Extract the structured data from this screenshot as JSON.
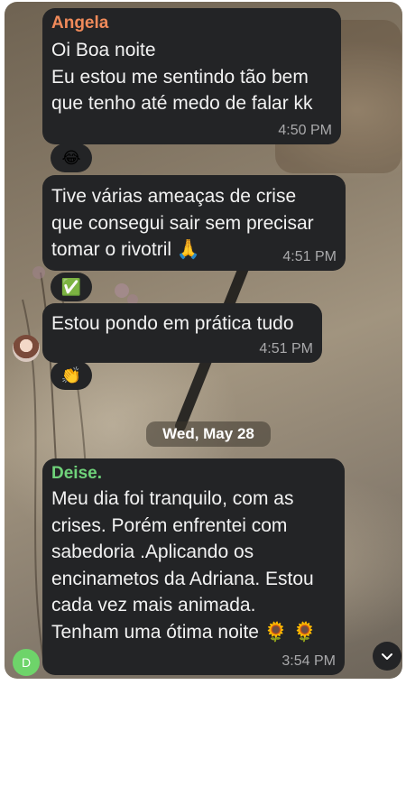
{
  "colors": {
    "bubble_bg": "#232426",
    "angela_name": "#f08a5a",
    "deise_name": "#6fd27a",
    "time_text": "#a9a9ab",
    "avatar_d": "#6ed46a"
  },
  "messages": [
    {
      "sender": "Angela",
      "lines": [
        "Oi Boa noite",
        "Eu estou me sentindo tão bem",
        "que tenho até medo de falar kk"
      ],
      "time": "4:50 PM",
      "reaction": "😂"
    },
    {
      "sender": "",
      "lines": [
        "Tive várias ameaças de crise",
        "que consegui sair sem precisar",
        "tomar o rivotril 🙏"
      ],
      "time": "4:51 PM",
      "reaction": "✅"
    },
    {
      "sender": "",
      "lines": [
        "Estou pondo em prática tudo"
      ],
      "time": "4:51 PM",
      "reaction": "👏"
    },
    {
      "sender": "Deise.",
      "lines": [
        "Meu dia foi tranquilo, com as",
        "crises. Porém enfrentei com",
        "sabedoria .Aplicando os",
        "encinametos da Adriana. Estou",
        "cada vez mais animada.",
        "Tenham uma ótima noite 🌻 🌻"
      ],
      "time": "3:54 PM"
    }
  ],
  "date_separator": "Wed, May 28",
  "avatars": {
    "deise_initial": "D"
  },
  "icons": {
    "scroll_down": "chevron-down-icon"
  }
}
